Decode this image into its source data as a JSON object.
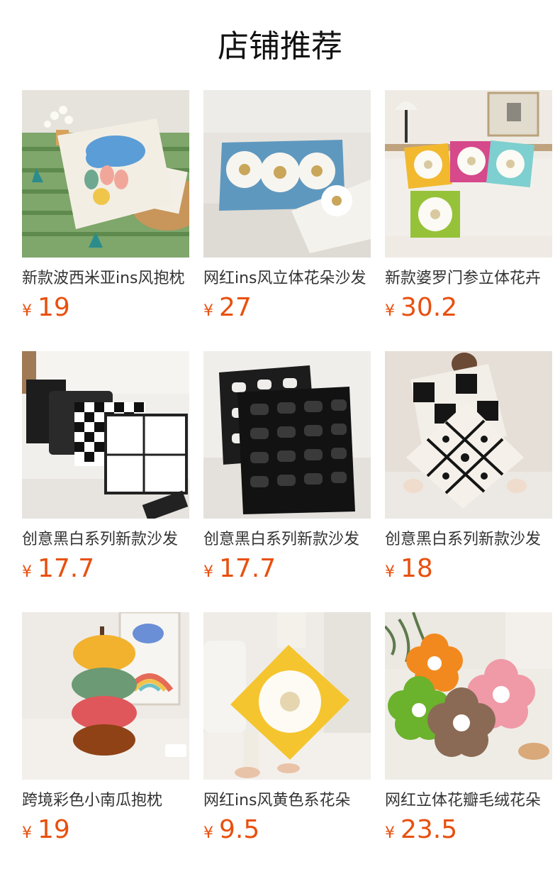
{
  "page": {
    "title": "店铺推荐"
  },
  "currency": "¥",
  "products": [
    {
      "name": "新款波西米亚ins风抱枕",
      "price": "19",
      "image": "cloud-raindrop-tufted-pillow"
    },
    {
      "name": "网红ins风立体花朵沙发",
      "price": "27",
      "image": "blue-lumbar-daisy-pillow"
    },
    {
      "name": "新款婆罗门参立体花卉",
      "price": "30.2",
      "image": "colorful-daisy-pillow-set"
    },
    {
      "name": "创意黑白系列新款沙发",
      "price": "17.7",
      "image": "black-white-checker-pillows"
    },
    {
      "name": "创意黑白系列新款沙发",
      "price": "17.7",
      "image": "black-woven-leather-pillow"
    },
    {
      "name": "创意黑白系列新款沙发",
      "price": "18",
      "image": "black-white-tufted-pillows"
    },
    {
      "name": "跨境彩色小南瓜抱枕",
      "price": "19",
      "image": "stacked-pumpkin-pillows"
    },
    {
      "name": "网红ins风黄色系花朵",
      "price": "9.5",
      "image": "yellow-daisy-pillow"
    },
    {
      "name": "网红立体花瓣毛绒花朵",
      "price": "23.5",
      "image": "plush-flower-cushions"
    }
  ]
}
